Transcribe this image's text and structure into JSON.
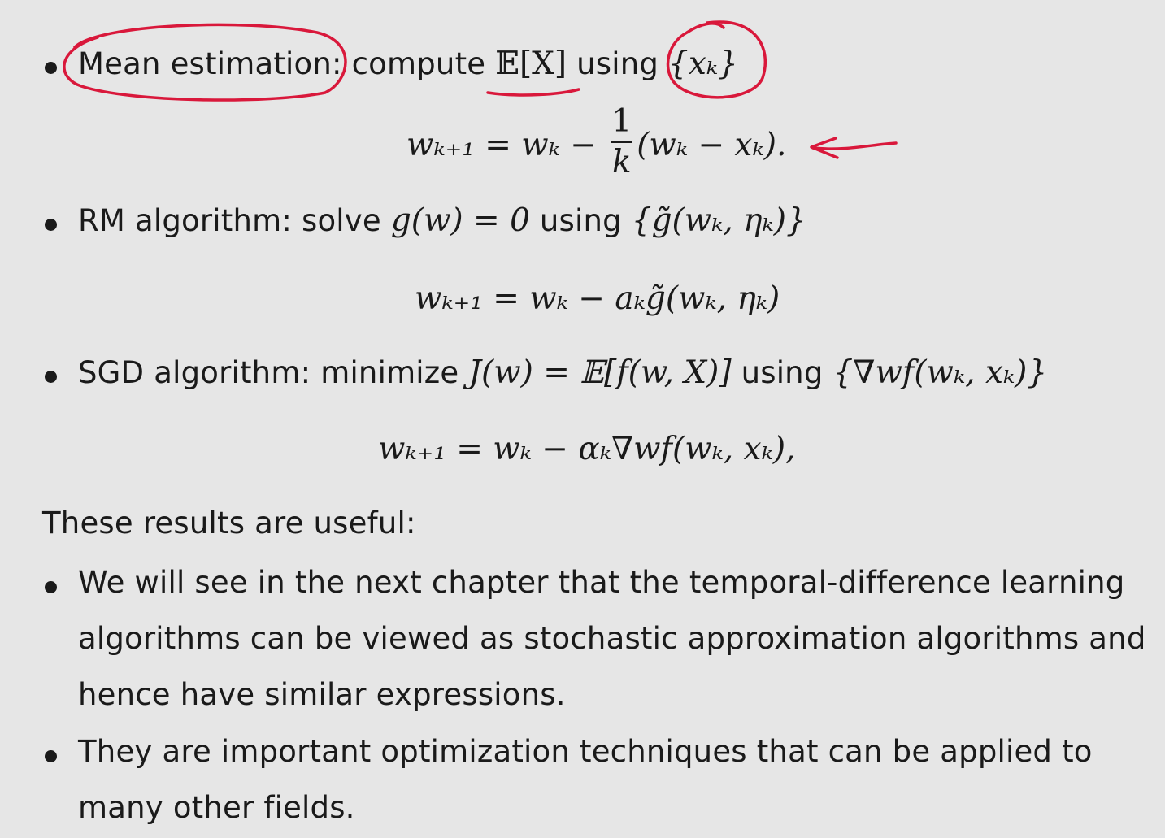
{
  "items": {
    "mean": {
      "label": "Mean estimation:",
      "text": " compute ",
      "expr": "𝔼[X]",
      "using": " using ",
      "data": "{xₖ}",
      "formula_lhs": "wₖ₊₁ = wₖ − ",
      "formula_num": "1",
      "formula_den": "k",
      "formula_rhs": "(wₖ − xₖ)."
    },
    "rm": {
      "label": "RM algorithm:",
      "text": " solve ",
      "expr": "g(w) = 0",
      "using": " using ",
      "data": "{g̃(wₖ, ηₖ)}",
      "formula": "wₖ₊₁ = wₖ − aₖg̃(wₖ, ηₖ)"
    },
    "sgd": {
      "label": "SGD algorithm:",
      "text": " minimize ",
      "expr": "J(w) = 𝔼[f(w, X)]",
      "using": " using ",
      "data": "{∇wf(wₖ, xₖ)}",
      "formula": "wₖ₊₁ = wₖ − αₖ∇wf(wₖ, xₖ),"
    }
  },
  "conclusion": {
    "heading": "These results are useful:",
    "bullet1_line1": "We will see in the next chapter that the temporal-difference learning",
    "bullet1_line2": "algorithms can be viewed as stochastic approximation algorithms and",
    "bullet1_line3": "hence have similar expressions.",
    "bullet2_line1": "They are important optimization techniques that can be applied to",
    "bullet2_line2": "many other fields."
  },
  "colors": {
    "background": "#e6e6e6",
    "text": "#1a1a1a",
    "annotation": "#d9183b"
  }
}
